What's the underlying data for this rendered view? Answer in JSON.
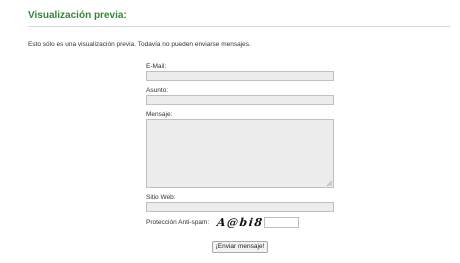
{
  "page": {
    "title": "Visualización previa:",
    "notice": "Esto sólo es una visualización previa. Todavía no pueden enviarse mensajes."
  },
  "form": {
    "email_label": "E-Mail:",
    "email_value": "",
    "subject_label": "Asunto:",
    "subject_value": "",
    "message_label": "Mensaje:",
    "message_value": "",
    "website_label": "Sitio Web:",
    "website_value": "",
    "antispam_label": "Protección Anti-spam:",
    "captcha_text": "A@bi8",
    "captcha_value": "",
    "submit_label": "¡Enviar mensaje!"
  },
  "colors": {
    "title": "#2f8a2f",
    "field_background": "#ececec",
    "field_border": "#bfbfbf"
  }
}
